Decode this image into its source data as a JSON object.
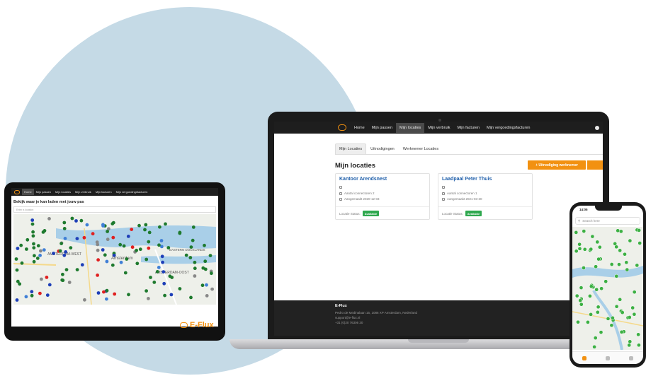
{
  "colors": {
    "brand": "#f29111",
    "success": "#2fa84f",
    "link": "#1f5faa",
    "background_circle": "#c5dae6"
  },
  "laptop": {
    "nav": {
      "logo_icon": "e-flux-logo-icon",
      "items": [
        {
          "label": "Home"
        },
        {
          "label": "Mijn passen"
        },
        {
          "label": "Mijn locaties"
        },
        {
          "label": "Mijn verbruik"
        },
        {
          "label": "Mijn facturen"
        },
        {
          "label": "Mijn vergoedingsfacturen"
        }
      ],
      "active_index": 2,
      "user_icon": "user-icon"
    },
    "tabs": [
      {
        "label": "Mijn Locaties"
      },
      {
        "label": "Uitnodigingen"
      },
      {
        "label": "Werknemer Locaties"
      }
    ],
    "title": "Mijn locaties",
    "invite_button": "+ Uitnodiging werknemer",
    "cards": [
      {
        "name": "Kantoor Arendsnest",
        "address": "",
        "connectors": "Aantal connectoren 2",
        "added": "Aangemaakt 2020-12-03",
        "status_label": "Locatie Status:",
        "status": "Available"
      },
      {
        "name": "Laadpaal Peter Thuis",
        "address": "",
        "connectors": "Aantal connectoren 1",
        "added": "Aangemaakt 2021-03-30",
        "status_label": "Locatie Status:",
        "status": "Available"
      }
    ],
    "footer": {
      "brand": "E-Flux",
      "address": "Pedro de Medinalaan 15, 1086 XP Amsterdam, Nederland",
      "email": "support@e-flux.nl",
      "phone": "+31 (0)20 76306 30"
    }
  },
  "tablet": {
    "nav": {
      "items": [
        {
          "label": "Home"
        },
        {
          "label": "Mijn passen"
        },
        {
          "label": "Mijn locaties"
        },
        {
          "label": "Mijn verbruik"
        },
        {
          "label": "Mijn facturen"
        },
        {
          "label": "Mijn vergoedingsfacturen"
        }
      ],
      "active_index": 0
    },
    "title": "Bekijk waar je kan laden met jouw pas",
    "search_placeholder": "Enter a location",
    "map_labels": [
      {
        "label": "AMSTERDAM-WEST"
      },
      {
        "label": "Amsterdam"
      },
      {
        "label": "EASTERN DOCKLANDS"
      },
      {
        "label": "AMSTERDAM-OOST"
      }
    ],
    "brand": "E-Flux"
  },
  "phone": {
    "time": "14:05",
    "search_placeholder": "Search here"
  }
}
